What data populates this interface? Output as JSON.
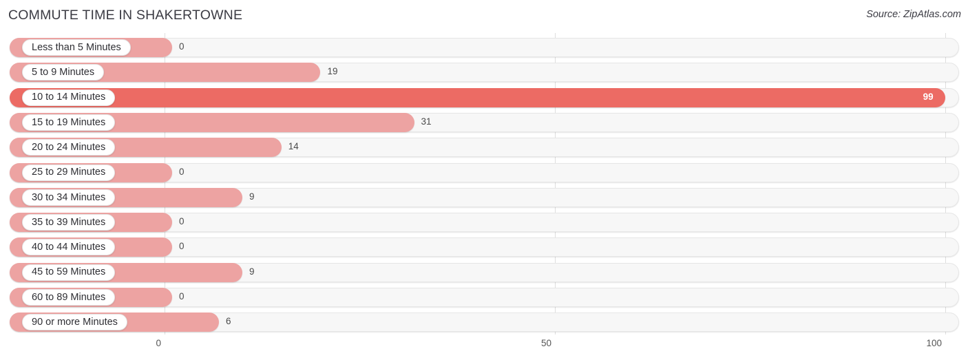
{
  "header": {
    "title": "COMMUTE TIME IN SHAKERTOWNE",
    "source": "Source: ZipAtlas.com"
  },
  "colors": {
    "bar_normal": "#eda3a2",
    "bar_highlight": "#ec6b64",
    "track": "#f7f7f7",
    "gridline": "#dedede",
    "title_text": "#3b3b43",
    "value_text": "#4a4a4a"
  },
  "chart_data": {
    "type": "bar",
    "orientation": "horizontal",
    "title": "COMMUTE TIME IN SHAKERTOWNE",
    "xlabel": "",
    "ylabel": "",
    "xlim": [
      0,
      100
    ],
    "xticks": [
      0,
      50,
      100
    ],
    "xtick_labels": [
      "0",
      "50",
      "100"
    ],
    "grid": true,
    "legend": false,
    "categories": [
      "Less than 5 Minutes",
      "5 to 9 Minutes",
      "10 to 14 Minutes",
      "15 to 19 Minutes",
      "20 to 24 Minutes",
      "25 to 29 Minutes",
      "30 to 34 Minutes",
      "35 to 39 Minutes",
      "40 to 44 Minutes",
      "45 to 59 Minutes",
      "60 to 89 Minutes",
      "90 or more Minutes"
    ],
    "values": [
      0,
      19,
      99,
      31,
      14,
      0,
      9,
      0,
      0,
      9,
      0,
      6
    ],
    "value_labels": [
      "0",
      "19",
      "99",
      "31",
      "14",
      "0",
      "9",
      "0",
      "0",
      "9",
      "0",
      "6"
    ],
    "highlight_index": 2
  }
}
